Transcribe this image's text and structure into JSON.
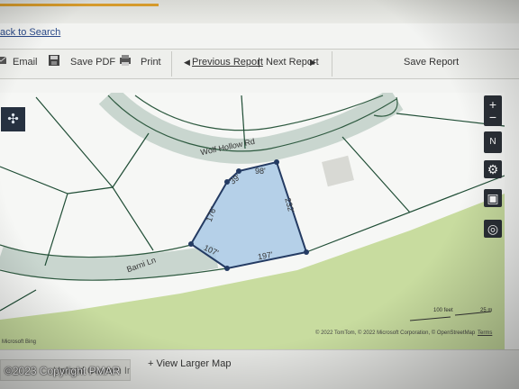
{
  "nav": {
    "back_label": "ack to Search"
  },
  "toolbar": {
    "email_label": "Email",
    "save_pdf_label": "Save PDF",
    "print_label": "Print",
    "prev_report_label": "Previous Report",
    "divider": "|",
    "next_report_label": "Next Report",
    "save_report_label": "Save Report"
  },
  "map": {
    "roads": [
      "Wolf Hollow Rd",
      "Barni Ln"
    ],
    "dimensions": [
      "39'",
      "98'",
      "232'",
      "197'",
      "107'",
      "176'"
    ],
    "scale_labels": [
      "100 feet",
      "25 m"
    ],
    "attribution": "© 2022 TomTom, © 2022 Microsoft Corporation, © OpenStreetMap",
    "terms_label": "Terms",
    "bing_label": "Microsoft Bing",
    "controls": {
      "zoom_in": "+",
      "zoom_out": "−",
      "compass": "N",
      "settings_icon": "gear-icon",
      "layers_icon": "layers-icon",
      "locate_icon": "crosshair-icon",
      "expand_icon": "expand-arrows-icon"
    },
    "colors": {
      "parcel_fill": "#a9c9e5",
      "green_area": "#c8dc9f",
      "lines": "#1f4d35",
      "road": "#9fb3a9"
    }
  },
  "footer": {
    "custom_image_label": "Upload Custom Image",
    "larger_map_label": "+ View Larger Map",
    "copyright": "©2023 Copyright PMAR"
  }
}
